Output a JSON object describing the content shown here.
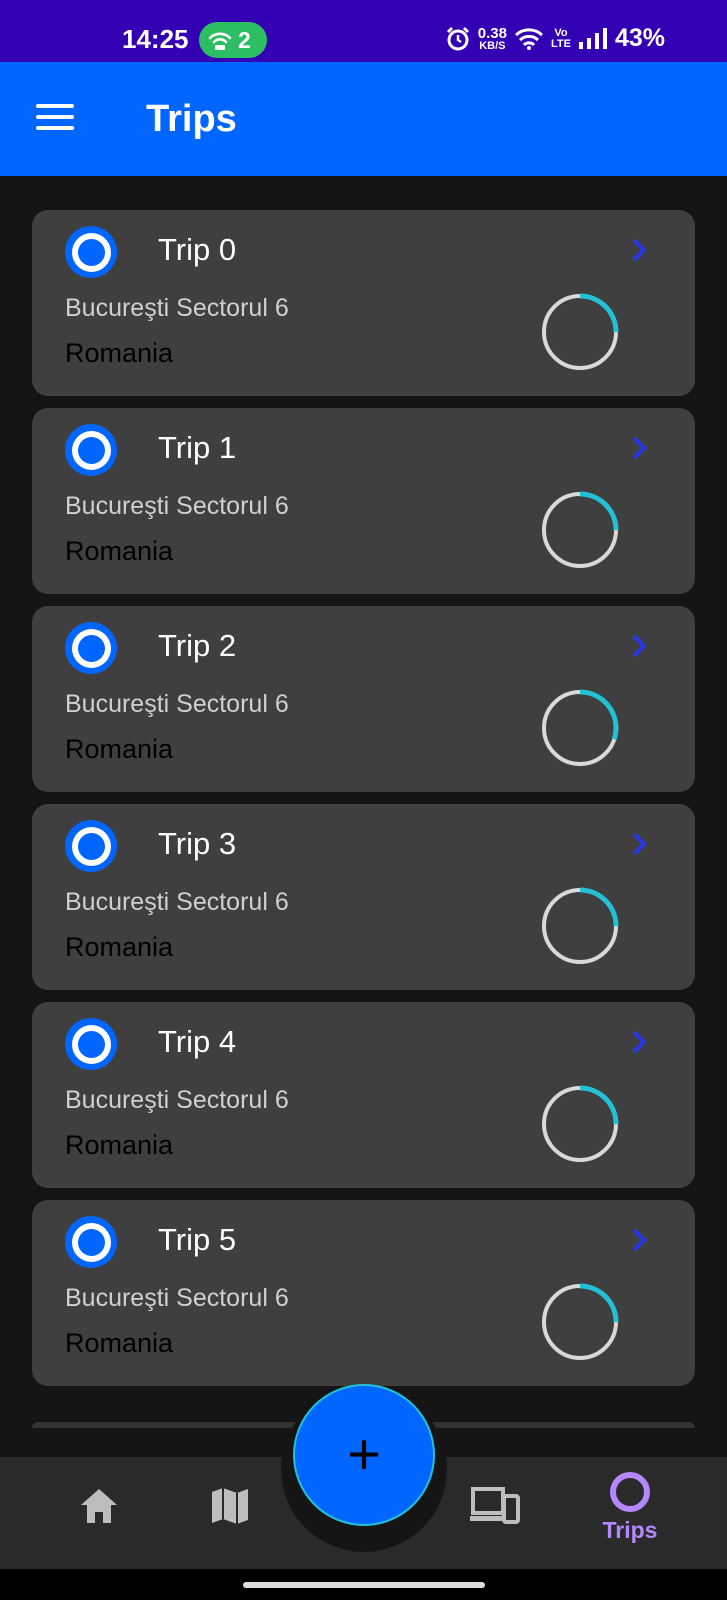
{
  "status_bar": {
    "time": "14:25",
    "hotspot_count": "2",
    "speed_value": "0.38",
    "speed_unit": "KB/S",
    "volte_top": "Vo",
    "volte_bottom": "LTE",
    "battery": "43%"
  },
  "app_bar": {
    "title": "Trips"
  },
  "trips": [
    {
      "title": "Trip 0",
      "city": "Bucureşti Sectorul 6",
      "country": "Romania",
      "progress": 0.25
    },
    {
      "title": "Trip 1",
      "city": "Bucureşti Sectorul 6",
      "country": "Romania",
      "progress": 0.25
    },
    {
      "title": "Trip 2",
      "city": "Bucureşti Sectorul 6",
      "country": "Romania",
      "progress": 0.3
    },
    {
      "title": "Trip 3",
      "city": "Bucureşti Sectorul 6",
      "country": "Romania",
      "progress": 0.25
    },
    {
      "title": "Trip 4",
      "city": "Bucureşti Sectorul 6",
      "country": "Romania",
      "progress": 0.25
    },
    {
      "title": "Trip 5",
      "city": "Bucureşti Sectorul 6",
      "country": "Romania",
      "progress": 0.25
    }
  ],
  "fab": {
    "icon": "plus-icon",
    "symbol": "+"
  },
  "bottom_nav": {
    "items": [
      {
        "icon": "home-icon",
        "label": ""
      },
      {
        "icon": "map-icon",
        "label": ""
      },
      {
        "icon": "devices-icon",
        "label": ""
      },
      {
        "icon": "trips-ring-icon",
        "label": "Trips"
      }
    ]
  },
  "colors": {
    "accent": "#0066ff",
    "status_bar": "#3300b3",
    "progress_track": "#d9d9d9",
    "progress_fill": "#22c1d6",
    "active_nav": "#b388ff",
    "card": "#3f3f3f"
  }
}
